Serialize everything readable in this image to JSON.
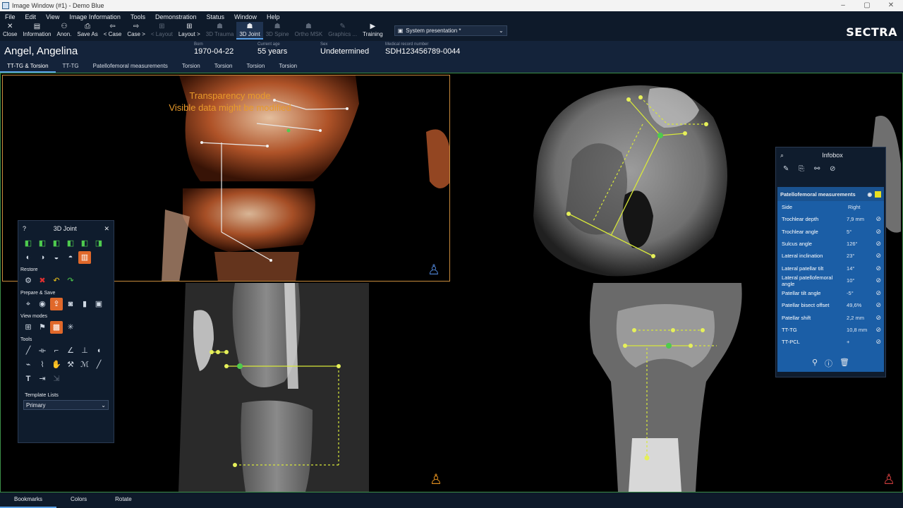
{
  "window": {
    "title": "Image Window (#1) - Demo Blue",
    "controls": [
      "–",
      "▢",
      "✕"
    ]
  },
  "menu": [
    "File",
    "Edit",
    "View",
    "Image Information",
    "Tools",
    "Demonstration",
    "Status",
    "Window",
    "Help"
  ],
  "toolbar": {
    "buttons": [
      {
        "label": "Close",
        "icon": "close-icon",
        "glyph": "✕",
        "state": "normal"
      },
      {
        "label": "Information",
        "icon": "clipboard-icon",
        "glyph": "▤",
        "state": "normal"
      },
      {
        "label": "Anon.",
        "icon": "anonymize-icon",
        "glyph": "⚇",
        "state": "normal"
      },
      {
        "label": "Save As",
        "icon": "save-icon",
        "glyph": "⎙",
        "state": "normal"
      },
      {
        "label": "< Case",
        "icon": "prev-case-icon",
        "glyph": "⇦",
        "state": "normal"
      },
      {
        "label": "Case >",
        "icon": "next-case-icon",
        "glyph": "⇨",
        "state": "normal"
      },
      {
        "label": "< Layout",
        "icon": "prev-layout-icon",
        "glyph": "⊞",
        "state": "disabled"
      },
      {
        "label": "Layout >",
        "icon": "next-layout-icon",
        "glyph": "⊞",
        "state": "normal"
      },
      {
        "label": "3D Trauma",
        "icon": "trauma-3d-icon",
        "glyph": "☗",
        "state": "disabled"
      },
      {
        "label": "3D Joint",
        "icon": "joint-3d-icon",
        "glyph": "☗",
        "state": "active"
      },
      {
        "label": "3D Spine",
        "icon": "spine-3d-icon",
        "glyph": "☗",
        "state": "disabled"
      },
      {
        "label": "Ortho MSK",
        "icon": "ortho-msk-icon",
        "glyph": "☗",
        "state": "disabled"
      },
      {
        "label": "Graphics ...",
        "icon": "graphics-icon",
        "glyph": "✎",
        "state": "disabled"
      },
      {
        "label": "Training",
        "icon": "training-icon",
        "glyph": "▶",
        "state": "normal"
      }
    ],
    "presentation_select": "System presentation *",
    "brand": "SECTRA"
  },
  "patient": {
    "name": "Angel, Angelina",
    "born_label": "Born",
    "born": "1970-04-22",
    "age_label": "Current age",
    "age": "55 years",
    "sex_label": "Sex",
    "sex": "Undetermined",
    "mrn_label": "Medical record number",
    "mrn": "SDH123456789-0044"
  },
  "tabs": [
    "TT-TG & Torsion",
    "TT-TG",
    "Patellofemoral measurements",
    "Torsion",
    "Torsion",
    "Torsion",
    "Torsion"
  ],
  "viewport3d": {
    "line1": "Transparency mode",
    "line2": "Visible data might be modified"
  },
  "joint_panel": {
    "title": "3D Joint",
    "sections": {
      "restore": "Restore",
      "prepare": "Prepare & Save",
      "view_modes": "View modes",
      "tools": "Tools"
    },
    "template_label": "Template Lists",
    "template_value": "Primary"
  },
  "infobox": {
    "title": "Infobox",
    "group": "Patellofemoral measurements",
    "header_side": "Side",
    "header_value": "Right",
    "rows": [
      {
        "name": "Trochlear depth",
        "value": "7,9 mm"
      },
      {
        "name": "Trochlear angle",
        "value": "5°"
      },
      {
        "name": "Sulcus angle",
        "value": "126°"
      },
      {
        "name": "Lateral inclination",
        "value": "23°"
      },
      {
        "name": "Lateral patellar tilt",
        "value": "14°"
      },
      {
        "name": "Lateral patellofemoral angle",
        "value": "10°"
      },
      {
        "name": "Patellar tilt angle",
        "value": "-5°"
      },
      {
        "name": "Patellar bisect offset",
        "value": "49,6%"
      },
      {
        "name": "Patellar shift",
        "value": "2,2 mm"
      },
      {
        "name": "TT-TG",
        "value": "10,8 mm"
      },
      {
        "name": "TT-PCL",
        "value": "+"
      }
    ]
  },
  "bottom": [
    "Bookmarks",
    "Colors",
    "Rotate"
  ],
  "colors": {
    "accent": "#5aa0e6",
    "measure": "#d8e83a",
    "highlight": "#e0682a",
    "infobox_blue": "#1b5ea6"
  }
}
